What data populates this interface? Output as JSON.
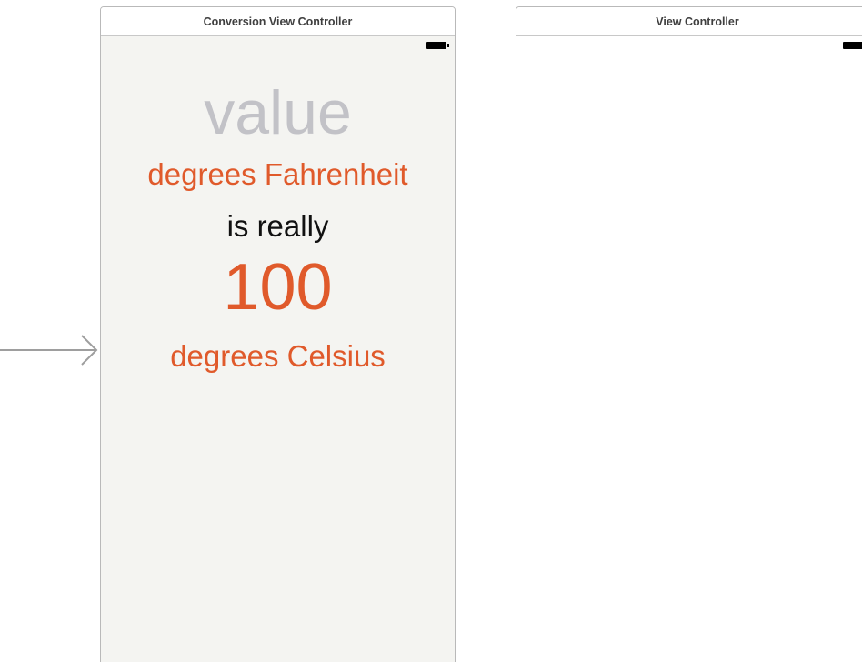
{
  "scenes": {
    "conversion": {
      "title": "Conversion View Controller",
      "labels": {
        "value": "value",
        "fahrenheit_unit": "degrees Fahrenheit",
        "is_really": "is really",
        "celsius_value": "100",
        "celsius_unit": "degrees Celsius"
      }
    },
    "view": {
      "title": "View Controller"
    }
  },
  "colors": {
    "accent": "#e05a2b",
    "placeholder": "#c2c2c7",
    "scene_background": "#f4f4f1",
    "text": "#111111"
  },
  "icons": {
    "entry_point": "arrow-right-icon",
    "status": "battery-icon"
  }
}
